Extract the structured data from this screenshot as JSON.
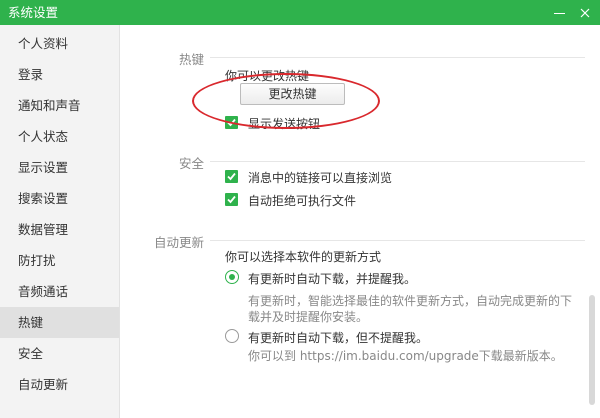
{
  "window": {
    "title": "系统设置"
  },
  "sidebar": {
    "items": [
      {
        "label": "个人资料"
      },
      {
        "label": "登录"
      },
      {
        "label": "通知和声音"
      },
      {
        "label": "个人状态"
      },
      {
        "label": "显示设置"
      },
      {
        "label": "搜索设置"
      },
      {
        "label": "数据管理"
      },
      {
        "label": "防打扰"
      },
      {
        "label": "音频通话"
      },
      {
        "label": "热键"
      },
      {
        "label": "安全"
      },
      {
        "label": "自动更新"
      }
    ],
    "active": "热键"
  },
  "hotkey": {
    "section_label": "热键",
    "desc": "你可以更改热键",
    "change_button": "更改热键",
    "show_send_button": {
      "label": "显示发送按钮",
      "checked": true
    }
  },
  "security": {
    "section_label": "安全",
    "links_browse": {
      "label": "消息中的链接可以直接浏览",
      "checked": true
    },
    "reject_exe": {
      "label": "自动拒绝可执行文件",
      "checked": true
    }
  },
  "auto_update": {
    "section_label": "自动更新",
    "desc": "你可以选择本软件的更新方式",
    "option_auto": {
      "label": "有更新时自动下载，并提醒我。",
      "detail_line1": "有更新时，智能选择最佳的软件更新方式，自动完成更新的下",
      "detail_line2": "载并及时提醒你安装。",
      "selected": true
    },
    "option_silent": {
      "label": "有更新时自动下载，但不提醒我。",
      "detail": "你可以到 https://im.baidu.com/upgrade下载最新版本。",
      "selected": false
    }
  },
  "colors": {
    "accent": "#2fb24c",
    "annotation": "#d9282d"
  }
}
